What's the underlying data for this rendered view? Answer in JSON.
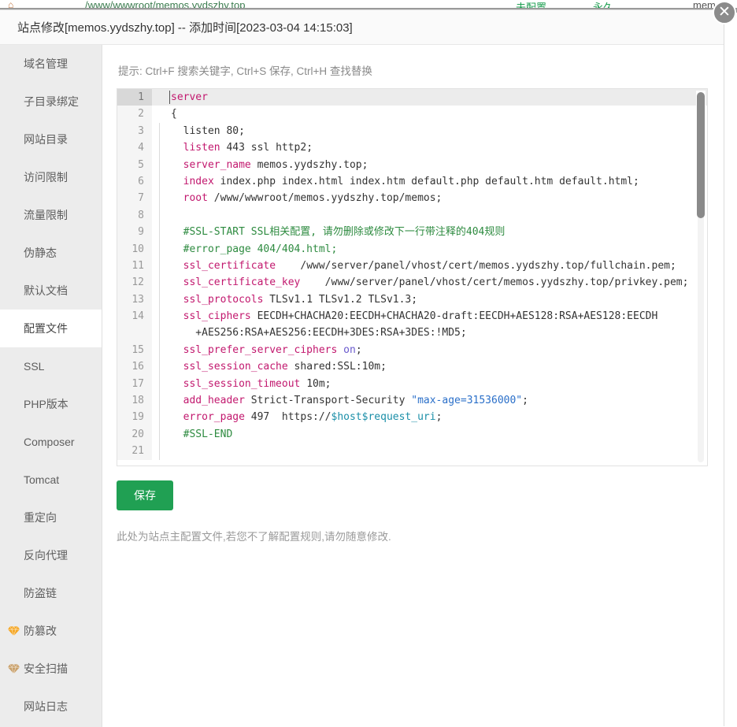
{
  "background": {
    "icon": "home-icon",
    "path": "/www/wwwroot/memos.yydszhy.top",
    "col1": "未配置",
    "col2": "永久",
    "col3": "memos"
  },
  "modal": {
    "title": "站点修改[memos.yydszhy.top] -- 添加时间[2023-03-04 14:15:03]",
    "close_label": "✕"
  },
  "sidebar": {
    "items": [
      {
        "label": "域名管理",
        "active": false,
        "icon": null
      },
      {
        "label": "子目录绑定",
        "active": false,
        "icon": null
      },
      {
        "label": "网站目录",
        "active": false,
        "icon": null
      },
      {
        "label": "访问限制",
        "active": false,
        "icon": null
      },
      {
        "label": "流量限制",
        "active": false,
        "icon": null
      },
      {
        "label": "伪静态",
        "active": false,
        "icon": null
      },
      {
        "label": "默认文档",
        "active": false,
        "icon": null
      },
      {
        "label": "配置文件",
        "active": true,
        "icon": null
      },
      {
        "label": "SSL",
        "active": false,
        "icon": null
      },
      {
        "label": "PHP版本",
        "active": false,
        "icon": null
      },
      {
        "label": "Composer",
        "active": false,
        "icon": null
      },
      {
        "label": "Tomcat",
        "active": false,
        "icon": null
      },
      {
        "label": "重定向",
        "active": false,
        "icon": null
      },
      {
        "label": "反向代理",
        "active": false,
        "icon": null
      },
      {
        "label": "防盗链",
        "active": false,
        "icon": null
      },
      {
        "label": "防篡改",
        "active": false,
        "icon": "gem-icon",
        "icon_color": "#f5a623"
      },
      {
        "label": "安全扫描",
        "active": false,
        "icon": "gem-icon",
        "icon_color": "#c9a06a"
      },
      {
        "label": "网站日志",
        "active": false,
        "icon": null
      }
    ]
  },
  "content": {
    "hint": "提示: Ctrl+F 搜索关键字, Ctrl+S 保存, Ctrl+H 查找替换",
    "save_label": "保存",
    "foot_note": "此处为站点主配置文件,若您不了解配置规则,请勿随意修改.",
    "scroll_position": "top"
  },
  "editor": {
    "active_line": 1,
    "total_lines": 21,
    "lines": [
      {
        "n": "1",
        "indent": false,
        "tokens": [
          {
            "t": "kw",
            "v": "server"
          }
        ]
      },
      {
        "n": "2",
        "indent": false,
        "tokens": [
          {
            "t": "plain",
            "v": "{"
          }
        ]
      },
      {
        "n": "3",
        "indent": true,
        "tokens": [
          {
            "t": "plain",
            "v": "  listen 80;"
          }
        ]
      },
      {
        "n": "4",
        "indent": true,
        "tokens": [
          {
            "t": "kw",
            "v": "  listen"
          },
          {
            "t": "plain",
            "v": " 443 ssl http2;"
          }
        ]
      },
      {
        "n": "5",
        "indent": true,
        "tokens": [
          {
            "t": "kw",
            "v": "  server_name"
          },
          {
            "t": "plain",
            "v": " memos.yydszhy.top;"
          }
        ]
      },
      {
        "n": "6",
        "indent": true,
        "tokens": [
          {
            "t": "kw",
            "v": "  index"
          },
          {
            "t": "plain",
            "v": " index.php index.html index.htm default.php default.htm default.html;"
          }
        ]
      },
      {
        "n": "7",
        "indent": true,
        "tokens": [
          {
            "t": "kw",
            "v": "  root"
          },
          {
            "t": "plain",
            "v": " /www/wwwroot/memos.yydszhy.top/memos;"
          }
        ]
      },
      {
        "n": "8",
        "indent": true,
        "tokens": [
          {
            "t": "plain",
            "v": ""
          }
        ]
      },
      {
        "n": "9",
        "indent": true,
        "tokens": [
          {
            "t": "cm",
            "v": "  #SSL-START SSL相关配置, 请勿删除或修改下一行带注释的404规则"
          }
        ]
      },
      {
        "n": "10",
        "indent": true,
        "tokens": [
          {
            "t": "cm",
            "v": "  #error_page 404/404.html;"
          }
        ]
      },
      {
        "n": "11",
        "indent": true,
        "tokens": [
          {
            "t": "kw",
            "v": "  ssl_certificate"
          },
          {
            "t": "plain",
            "v": "    /www/server/panel/vhost/cert/memos.yydszhy.top/fullchain.pem;"
          }
        ]
      },
      {
        "n": "12",
        "indent": true,
        "tokens": [
          {
            "t": "kw",
            "v": "  ssl_certificate_key"
          },
          {
            "t": "plain",
            "v": "    /www/server/panel/vhost/cert/memos.yydszhy.top/privkey.pem;"
          }
        ]
      },
      {
        "n": "13",
        "indent": true,
        "tokens": [
          {
            "t": "kw",
            "v": "  ssl_protocols"
          },
          {
            "t": "plain",
            "v": " TLSv1.1 TLSv1.2 TLSv1.3;"
          }
        ]
      },
      {
        "n": "14",
        "indent": true,
        "tokens": [
          {
            "t": "kw",
            "v": "  ssl_ciphers"
          },
          {
            "t": "plain",
            "v": " EECDH+CHACHA20:EECDH+CHACHA20-draft:EECDH+AES128:RSA+AES128:EECDH"
          }
        ]
      },
      {
        "n": "",
        "indent": true,
        "tokens": [
          {
            "t": "plain",
            "v": "    +AES256:RSA+AES256:EECDH+3DES:RSA+3DES:!MD5;"
          }
        ]
      },
      {
        "n": "15",
        "indent": true,
        "tokens": [
          {
            "t": "kw",
            "v": "  ssl_prefer_server_ciphers"
          },
          {
            "t": "bool",
            "v": " on"
          },
          {
            "t": "plain",
            "v": ";"
          }
        ]
      },
      {
        "n": "16",
        "indent": true,
        "tokens": [
          {
            "t": "kw",
            "v": "  ssl_session_cache"
          },
          {
            "t": "plain",
            "v": " shared:SSL:10m;"
          }
        ]
      },
      {
        "n": "17",
        "indent": true,
        "tokens": [
          {
            "t": "kw",
            "v": "  ssl_session_timeout"
          },
          {
            "t": "plain",
            "v": " 10m;"
          }
        ]
      },
      {
        "n": "18",
        "indent": true,
        "tokens": [
          {
            "t": "kw",
            "v": "  add_header"
          },
          {
            "t": "plain",
            "v": " Strict-Transport-Security "
          },
          {
            "t": "str",
            "v": "\"max-age=31536000\""
          },
          {
            "t": "plain",
            "v": ";"
          }
        ]
      },
      {
        "n": "19",
        "indent": true,
        "tokens": [
          {
            "t": "kw",
            "v": "  error_page"
          },
          {
            "t": "plain",
            "v": " 497  https://"
          },
          {
            "t": "var",
            "v": "$host$request_uri"
          },
          {
            "t": "plain",
            "v": ";"
          }
        ]
      },
      {
        "n": "20",
        "indent": true,
        "tokens": [
          {
            "t": "cm",
            "v": "  #SSL-END"
          }
        ]
      },
      {
        "n": "21",
        "indent": true,
        "tokens": [
          {
            "t": "plain",
            "v": ""
          }
        ]
      }
    ]
  }
}
